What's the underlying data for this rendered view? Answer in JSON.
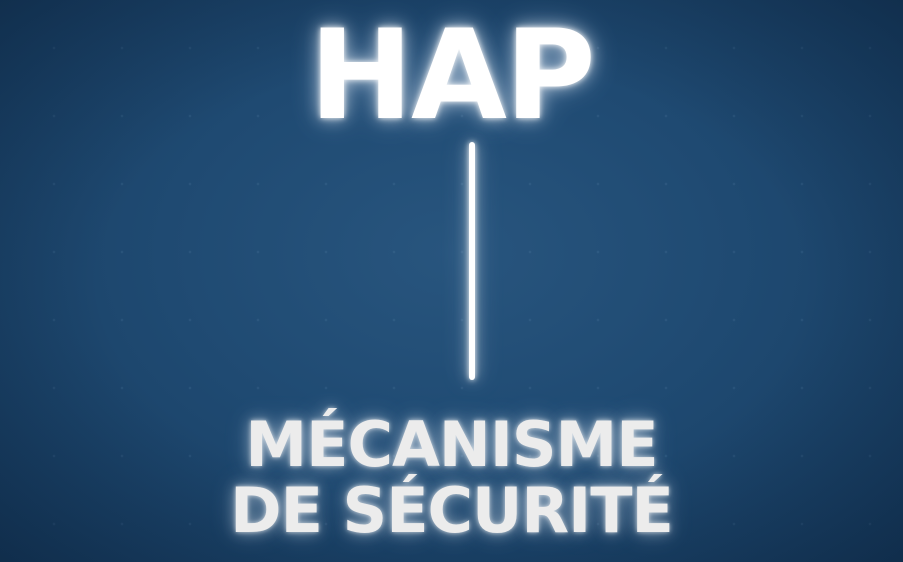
{
  "title": "HAP",
  "subtitle_lines": [
    "MÉCANISME",
    "DE SÉCURITÉ"
  ],
  "colors": {
    "background": "#1f4a72",
    "text": "#ffffff",
    "glow": "#c8e1ff"
  }
}
